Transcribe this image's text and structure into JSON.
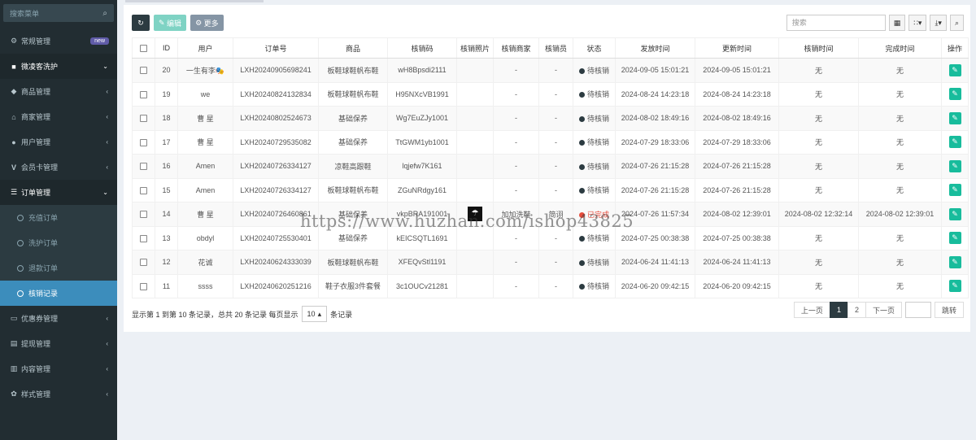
{
  "sidebar": {
    "search_placeholder": "搜索菜单",
    "items": [
      {
        "label": "常规管理",
        "icon": "cogs-icon",
        "badge": "new"
      },
      {
        "label": "微凌客洗护",
        "icon": "folder-icon",
        "open": true
      },
      {
        "label": "商品管理",
        "icon": "cube-icon"
      },
      {
        "label": "商家管理",
        "icon": "bank-icon"
      },
      {
        "label": "用户管理",
        "icon": "user-icon"
      },
      {
        "label": "会员卡管理",
        "icon": "vimeo-icon"
      },
      {
        "label": "订单管理",
        "icon": "list-icon",
        "open": true
      }
    ],
    "sub_items": [
      "充值订单",
      "洗护订单",
      "退款订单",
      "核销记录"
    ],
    "active_sub": "核销记录",
    "bottom_items": [
      {
        "label": "优惠券管理",
        "icon": "ticket-icon"
      },
      {
        "label": "提现管理",
        "icon": "money-icon"
      },
      {
        "label": "内容管理",
        "icon": "file-icon"
      },
      {
        "label": "样式管理",
        "icon": "paint-icon"
      }
    ]
  },
  "toolbar": {
    "edit_label": "编辑",
    "more_label": "更多",
    "search_placeholder": "搜索"
  },
  "table": {
    "headers": [
      "ID",
      "用户",
      "订单号",
      "商品",
      "核销码",
      "核销照片",
      "核销商家",
      "核销员",
      "状态",
      "发放时间",
      "更新时间",
      "核销时间",
      "完成时间",
      "操作"
    ],
    "rows": [
      {
        "id": "20",
        "user": "一生有李🎭",
        "order": "LXH20240905698241",
        "product": "板鞋球鞋帆布鞋",
        "code": "wH8Bpsdi2111",
        "photo": "",
        "merchant": "-",
        "staff": "-",
        "status": "待核销",
        "issued": "2024-09-05 15:01:21",
        "updated": "2024-09-05 15:01:21",
        "verified": "无",
        "completed": "无"
      },
      {
        "id": "19",
        "user": "we",
        "order": "LXH20240824132834",
        "product": "板鞋球鞋帆布鞋",
        "code": "H95NXcVB1991",
        "photo": "",
        "merchant": "-",
        "staff": "-",
        "status": "待核销",
        "issued": "2024-08-24 14:23:18",
        "updated": "2024-08-24 14:23:18",
        "verified": "无",
        "completed": "无"
      },
      {
        "id": "18",
        "user": "曹 星",
        "order": "LXH20240802524673",
        "product": "基础保养",
        "code": "Wg7EuZJy1001",
        "photo": "",
        "merchant": "-",
        "staff": "-",
        "status": "待核销",
        "issued": "2024-08-02 18:49:16",
        "updated": "2024-08-02 18:49:16",
        "verified": "无",
        "completed": "无"
      },
      {
        "id": "17",
        "user": "曹 星",
        "order": "LXH20240729535082",
        "product": "基础保养",
        "code": "TtGWM1yb1001",
        "photo": "",
        "merchant": "-",
        "staff": "-",
        "status": "待核销",
        "issued": "2024-07-29 18:33:06",
        "updated": "2024-07-29 18:33:06",
        "verified": "无",
        "completed": "无"
      },
      {
        "id": "16",
        "user": "Amen",
        "order": "LXH20240726334127",
        "product": "凉鞋高跟鞋",
        "code": "lqjefw7K161",
        "photo": "",
        "merchant": "-",
        "staff": "-",
        "status": "待核销",
        "issued": "2024-07-26 21:15:28",
        "updated": "2024-07-26 21:15:28",
        "verified": "无",
        "completed": "无"
      },
      {
        "id": "15",
        "user": "Amen",
        "order": "LXH20240726334127",
        "product": "板鞋球鞋帆布鞋",
        "code": "ZGuNRdgy161",
        "photo": "",
        "merchant": "-",
        "staff": "-",
        "status": "待核销",
        "issued": "2024-07-26 21:15:28",
        "updated": "2024-07-26 21:15:28",
        "verified": "无",
        "completed": "无"
      },
      {
        "id": "14",
        "user": "曹 星",
        "order": "LXH20240726460861",
        "product": "基础保养",
        "code": "vkpBRA191001",
        "photo": "photo",
        "merchant": "加加洗鞋",
        "staff": "简诩",
        "status": "已完成",
        "issued": "2024-07-26 11:57:34",
        "updated": "2024-08-02 12:39:01",
        "verified": "2024-08-02 12:32:14",
        "completed": "2024-08-02 12:39:01"
      },
      {
        "id": "13",
        "user": "obdyl",
        "order": "LXH20240725530401",
        "product": "基础保养",
        "code": "kEICSQTL1691",
        "photo": "",
        "merchant": "-",
        "staff": "-",
        "status": "待核销",
        "issued": "2024-07-25 00:38:38",
        "updated": "2024-07-25 00:38:38",
        "verified": "无",
        "completed": "无"
      },
      {
        "id": "12",
        "user": "花诚",
        "order": "LXH20240624333039",
        "product": "板鞋球鞋帆布鞋",
        "code": "XFEQvStl1191",
        "photo": "",
        "merchant": "-",
        "staff": "-",
        "status": "待核销",
        "issued": "2024-06-24 11:41:13",
        "updated": "2024-06-24 11:41:13",
        "verified": "无",
        "completed": "无"
      },
      {
        "id": "11",
        "user": "ssss",
        "order": "LXH20240620251216",
        "product": "鞋子衣服3件套餐",
        "code": "3c1OUCv21281",
        "photo": "",
        "merchant": "-",
        "staff": "-",
        "status": "待核销",
        "issued": "2024-06-20 09:42:15",
        "updated": "2024-06-20 09:42:15",
        "verified": "无",
        "completed": "无"
      }
    ]
  },
  "footer": {
    "info_prefix": "显示第 1 到第 10 条记录，总共 20 条记录 每页显示",
    "page_size": "10",
    "info_suffix": "条记录",
    "prev": "上一页",
    "pages": [
      "1",
      "2"
    ],
    "active_page": "1",
    "next": "下一页",
    "jump": "跳转"
  },
  "watermark": "https://www.huzhan.com/ishop43825",
  "colors": {
    "sidebar": "#222d32",
    "active": "#3c8dbc",
    "success": "#18bc9c",
    "danger": "#e74c3c"
  }
}
